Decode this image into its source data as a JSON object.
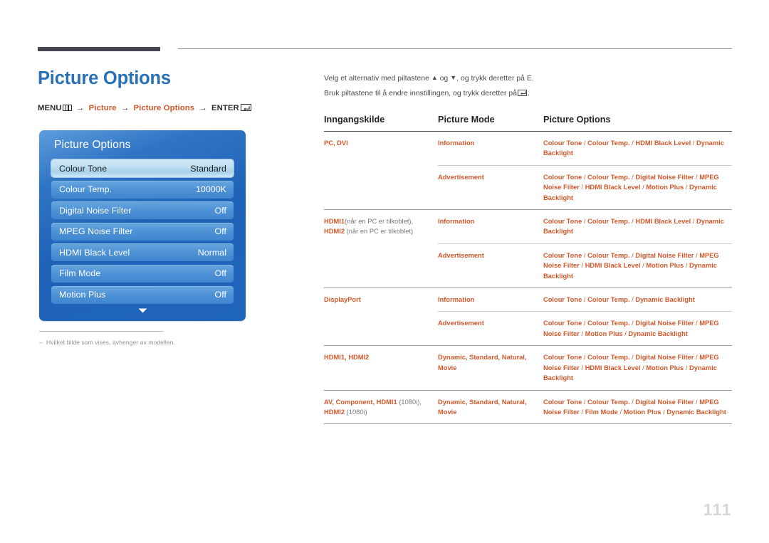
{
  "page": {
    "title": "Picture Options",
    "number": "111",
    "accent_blue": "#2a70b8",
    "accent_orange": "#d4572a"
  },
  "breadcrumb": {
    "menu_label": "MENU",
    "menu_icon": "menu-bars-icon",
    "arrow": "→",
    "item1": "Picture",
    "item2": "Picture Options",
    "enter_label": "ENTER",
    "enter_icon": "enter-key-icon"
  },
  "osd": {
    "title": "Picture Options",
    "chevron_icon": "chevron-down-icon",
    "rows": [
      {
        "label": "Colour Tone",
        "value": "Standard",
        "selected": true
      },
      {
        "label": "Colour Temp.",
        "value": "10000K",
        "selected": false
      },
      {
        "label": "Digital Noise Filter",
        "value": "Off",
        "selected": false
      },
      {
        "label": "MPEG Noise Filter",
        "value": "Off",
        "selected": false
      },
      {
        "label": "HDMI Black Level",
        "value": "Normal",
        "selected": false
      },
      {
        "label": "Film Mode",
        "value": "Off",
        "selected": false
      },
      {
        "label": "Motion Plus",
        "value": "Off",
        "selected": false
      }
    ]
  },
  "footnote": {
    "dash": "–",
    "text": "Hvilket bilde som vises, avhenger av modellen."
  },
  "intro": {
    "line1_a": "Velg et alternativ med piltastene",
    "line1_up": "▲",
    "line1_b": "og",
    "line1_down": "▼",
    "line1_c": ", og trykk deretter på E.",
    "line2_a": "Bruk piltastene til å endre innstillingen, og trykk deretter på",
    "line2_b": "."
  },
  "table": {
    "headers": {
      "source": "Inngangskilde",
      "mode": "Picture Mode",
      "options": "Picture Options"
    },
    "groups": [
      {
        "source": "PC, DVI",
        "source_suffix": "",
        "source_suffix2": "",
        "rows": [
          {
            "mode": "Information",
            "options": "Colour Tone / Colour Temp. / HDMI Black Level / Dynamic Backlight"
          },
          {
            "mode": "Advertisement",
            "options": "Colour Tone / Colour Temp. / Digital Noise Filter / MPEG Noise Filter / HDMI Black Level / Motion Plus / Dynamic Backlight"
          }
        ]
      },
      {
        "source": "HDMI1",
        "source_suffix": "(når en PC er tilkoblet),",
        "source2": "HDMI2",
        "source_suffix2": " (når en PC er tilkoblet)",
        "rows": [
          {
            "mode": "Information",
            "options": "Colour Tone / Colour Temp. / HDMI Black Level / Dynamic Backlight"
          },
          {
            "mode": "Advertisement",
            "options": "Colour Tone / Colour Temp. / Digital Noise Filter / MPEG Noise Filter / HDMI Black Level / Motion Plus / Dynamic Backlight"
          }
        ]
      },
      {
        "source": "DisplayPort",
        "source_suffix": "",
        "source_suffix2": "",
        "rows": [
          {
            "mode": "Information",
            "options": "Colour Tone / Colour Temp. / Dynamic Backlight"
          },
          {
            "mode": "Advertisement",
            "options": "Colour Tone / Colour Temp. / Digital Noise Filter / MPEG Noise Filter / Motion Plus / Dynamic Backlight"
          }
        ]
      },
      {
        "source": "HDMI1, HDMI2",
        "source_suffix": "",
        "source_suffix2": "",
        "rows": [
          {
            "mode": "Dynamic, Standard, Natural, Movie",
            "options": "Colour Tone / Colour Temp. / Digital Noise Filter / MPEG Noise Filter / HDMI Black Level / Motion Plus / Dynamic Backlight"
          }
        ]
      },
      {
        "source": "AV, Component, HDMI1",
        "source_suffix": "(1080i),",
        "source2": "HDMI2",
        "source_suffix2": " (1080i)",
        "rows": [
          {
            "mode": "Dynamic, Standard, Natural, Movie",
            "options": "Colour Tone / Colour Temp. / Digital Noise Filter / MPEG Noise Filter / Film Mode / Motion Plus / Dynamic Backlight"
          }
        ]
      }
    ]
  }
}
